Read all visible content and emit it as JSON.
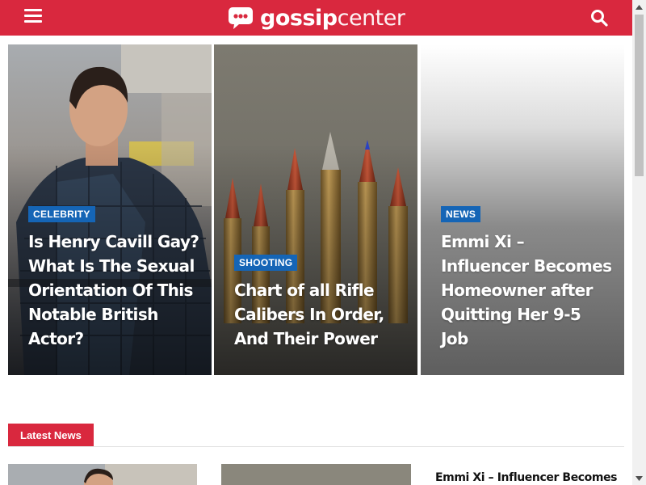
{
  "header": {
    "brand_bold": "gossip",
    "brand_light": "center",
    "color": "#d9283e",
    "menu_icon": "hamburger-menu-icon",
    "search_icon": "search-icon"
  },
  "featured": [
    {
      "category": "CELEBRITY",
      "title": "Is Henry Cavill Gay? What Is The Sexual Orientation Of This Notable British Actor?"
    },
    {
      "category": "SHOOTING",
      "title": "Chart of all Rifle Calibers In Order, And Their Power"
    },
    {
      "category": "NEWS",
      "title": "Emmi Xi – Influencer Becomes Homeowner after Quitting Her 9-5 Job"
    }
  ],
  "latest": {
    "tab_label": "Latest News",
    "first_headline": "Emmi Xi – Influencer Becomes"
  },
  "colors": {
    "accent": "#d9283e",
    "badge": "#1565b6"
  }
}
